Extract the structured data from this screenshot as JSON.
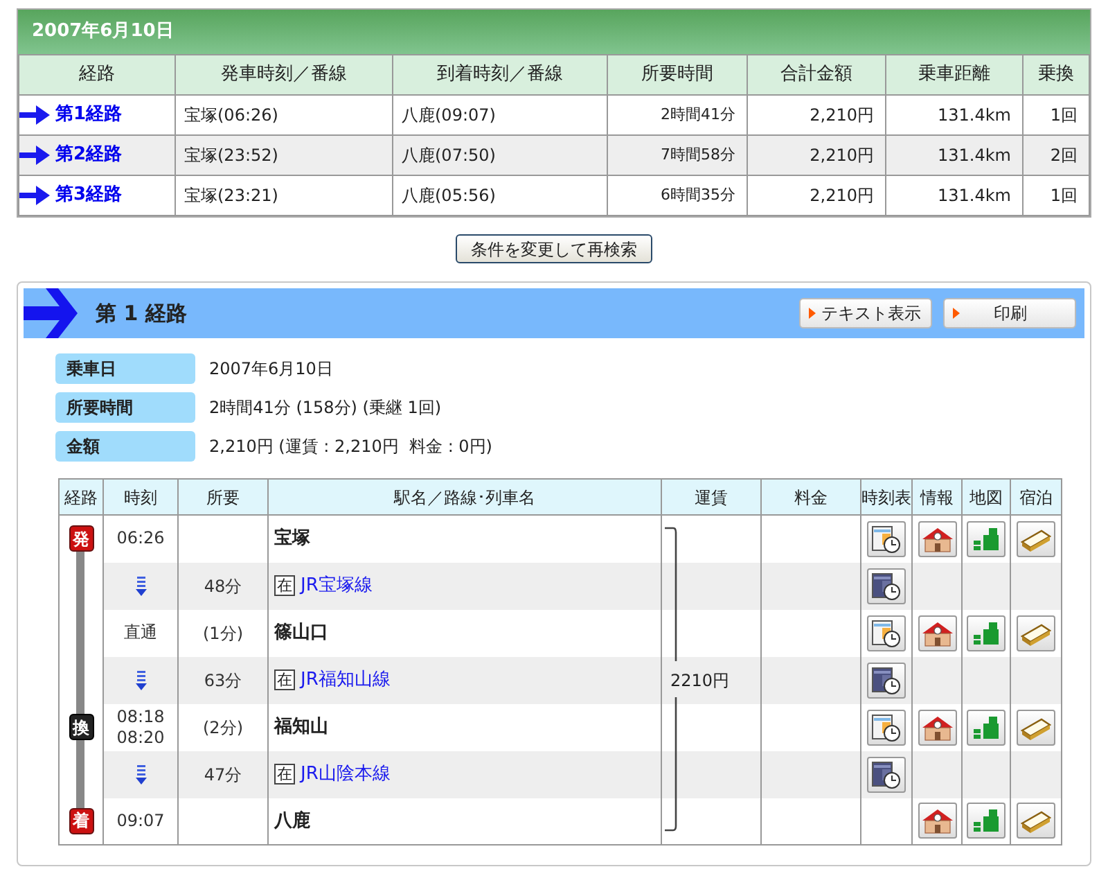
{
  "date_header": "2007年6月10日",
  "summary": {
    "columns": [
      "経路",
      "発車時刻／番線",
      "到着時刻／番線",
      "所要時間",
      "合計金額",
      "乗車距離",
      "乗換"
    ],
    "rows": [
      {
        "route": "第1経路",
        "departure": "宝塚(06:26)",
        "arrival": "八鹿(09:07)",
        "duration": "2時間41分",
        "fare": "2,210円",
        "distance": "131.4km",
        "transfers": "1回"
      },
      {
        "route": "第2経路",
        "departure": "宝塚(23:52)",
        "arrival": "八鹿(07:50)",
        "duration": "7時間58分",
        "fare": "2,210円",
        "distance": "131.4km",
        "transfers": "2回"
      },
      {
        "route": "第3経路",
        "departure": "宝塚(23:21)",
        "arrival": "八鹿(05:56)",
        "duration": "6時間35分",
        "fare": "2,210円",
        "distance": "131.4km",
        "transfers": "1回"
      }
    ]
  },
  "research_button": "条件を変更して再検索",
  "detail": {
    "title": "第 1 経路",
    "buttons": [
      "テキスト表示",
      "印刷"
    ],
    "info": [
      {
        "label": "乗車日",
        "value": "2007年6月10日"
      },
      {
        "label": "所要時間",
        "value": "2時間41分 (158分) (乗継 1回)"
      },
      {
        "label": "金額",
        "value": "2,210円 (運賃 : 2,210円  料金 : 0円)"
      }
    ],
    "columns": [
      "経路",
      "時刻",
      "所要",
      "駅名／路線･列車名",
      "運賃",
      "料金",
      "時刻表",
      "情報",
      "地図",
      "宿泊"
    ],
    "rows": [
      {
        "kind": "station",
        "marker": {
          "text": "発",
          "kind": "depart"
        },
        "times": [
          "06:26"
        ],
        "name": "宝塚",
        "icons": {
          "timetable": true,
          "info": true,
          "map": true,
          "lodging": true
        }
      },
      {
        "kind": "line",
        "duration": "48分",
        "badge": "在",
        "name": "JR宝塚線",
        "icons": {
          "timetable": true,
          "info": false,
          "map": false,
          "lodging": false
        }
      },
      {
        "kind": "station",
        "times": [
          "直通"
        ],
        "duration": "(1分)",
        "name": "篠山口",
        "icons": {
          "timetable": true,
          "info": true,
          "map": true,
          "lodging": true
        }
      },
      {
        "kind": "line",
        "duration": "63分",
        "badge": "在",
        "name": "JR福知山線",
        "fare": "2210円",
        "icons": {
          "timetable": true,
          "info": false,
          "map": false,
          "lodging": false
        }
      },
      {
        "kind": "station",
        "marker": {
          "text": "換",
          "kind": "transfer"
        },
        "times": [
          "08:18",
          "08:20"
        ],
        "duration": "(2分)",
        "name": "福知山",
        "icons": {
          "timetable": true,
          "info": true,
          "map": true,
          "lodging": true
        }
      },
      {
        "kind": "line",
        "duration": "47分",
        "badge": "在",
        "name": "JR山陰本線",
        "icons": {
          "timetable": true,
          "info": false,
          "map": false,
          "lodging": false
        }
      },
      {
        "kind": "station",
        "marker": {
          "text": "着",
          "kind": "arrive"
        },
        "times": [
          "09:07"
        ],
        "name": "八鹿",
        "icons": {
          "timetable": false,
          "info": true,
          "map": true,
          "lodging": true
        }
      }
    ]
  }
}
